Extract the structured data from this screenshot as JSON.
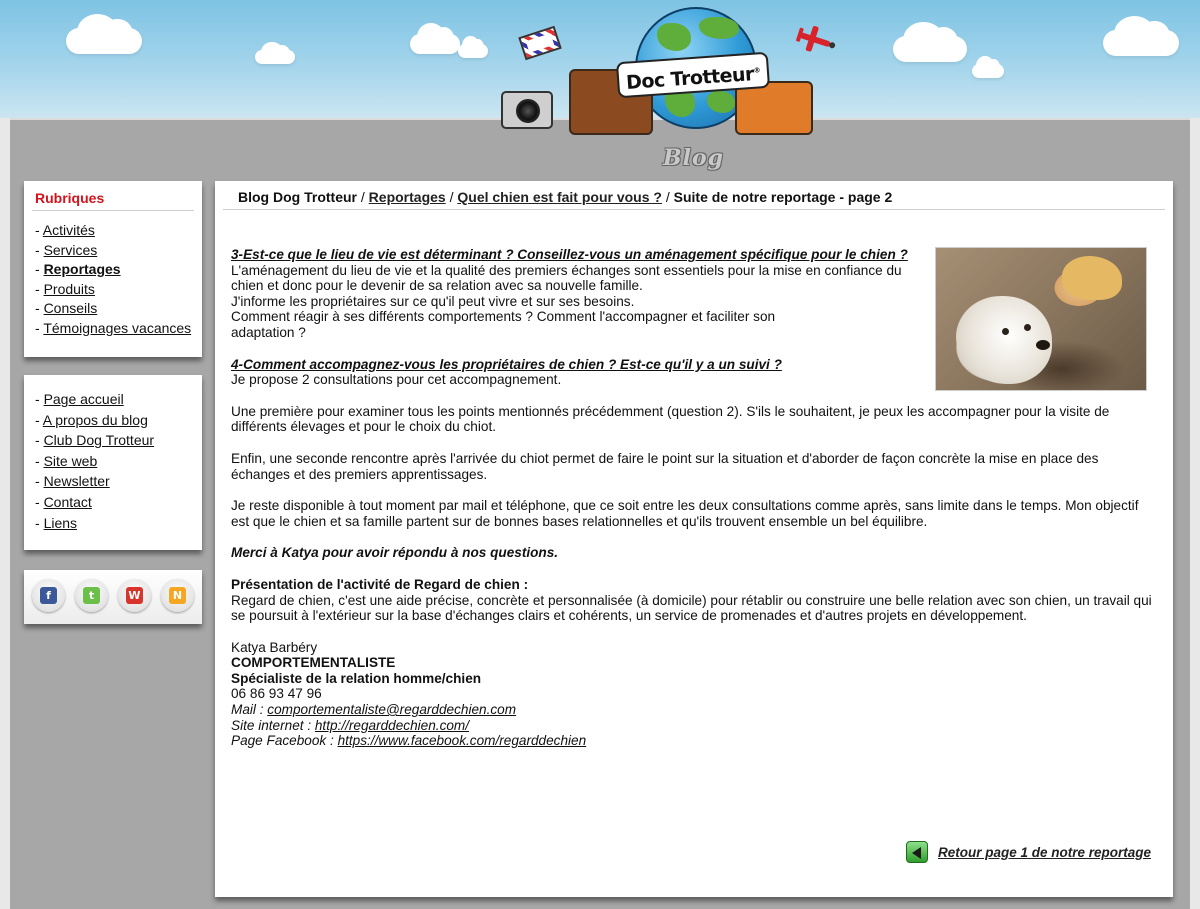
{
  "header": {
    "logo_text": "Doc Trotteur",
    "blog_word": "Blog"
  },
  "sidebar": {
    "rubriques_title": "Rubriques",
    "items": [
      {
        "label": "Activités"
      },
      {
        "label": "Services"
      },
      {
        "label": "Reportages"
      },
      {
        "label": "Produits"
      },
      {
        "label": "Conseils"
      },
      {
        "label": "Témoignages vacances"
      }
    ],
    "links": [
      {
        "label": "Page accueil"
      },
      {
        "label": "A propos du blog"
      },
      {
        "label": "Club Dog Trotteur"
      },
      {
        "label": "Site web"
      },
      {
        "label": "Newsletter"
      },
      {
        "label": "Contact"
      },
      {
        "label": "Liens"
      }
    ],
    "social": [
      {
        "icon": "facebook-icon",
        "glyph": "f",
        "color": "#3b5998"
      },
      {
        "icon": "twitter-icon",
        "glyph": "t",
        "color": "#6cc04a"
      },
      {
        "icon": "wikio-icon",
        "glyph": "W",
        "color": "#d8342c"
      },
      {
        "icon": "netvibes-icon",
        "glyph": "N",
        "color": "#f5a623"
      }
    ]
  },
  "breadcrumb": {
    "root": "Blog Dog Trotteur",
    "sep": " / ",
    "reportages": "Reportages",
    "article": "Quel chien est fait pour vous ?",
    "current": "Suite de notre reportage - page 2"
  },
  "content": {
    "q3_title": "3-Est-ce que le lieu de vie est déterminant ? Conseillez-vous un aménagement spécifique pour le chien ?",
    "q3_l1": "L'aménagement du lieu de vie et la qualité des premiers échanges sont essentiels pour la mise en confiance du",
    "q3_l2": "chien et donc pour le devenir de sa relation avec sa nouvelle famille.",
    "q3_l3": "J'informe les propriétaires sur ce qu'il peut vivre et sur ses besoins.",
    "q3_l4": "Comment réagir à ses différents comportements ? Comment l'accompagner et faciliter son",
    "q3_l5": "adaptation ?",
    "q4_title": "4-Comment accompagnez-vous les propriétaires de chien ? Est-ce qu'il y a un suivi ?",
    "q4_l1": "Je propose 2 consultations pour cet accompagnement.",
    "p1": "Une première pour examiner tous les points mentionnés précédemment (question 2). S'ils le souhaitent, je peux les accompagner pour la visite de différents élevages et pour le choix du chiot.",
    "p2": "Enfin, une seconde rencontre après l'arrivée du chiot permet de faire le point sur la situation et d'aborder de façon concrète la mise en place des échanges et des premiers apprentissages.",
    "p3": "Je reste disponible à tout moment par mail et téléphone, que ce soit entre les deux consultations comme après, sans limite dans le temps. Mon objectif est que le chien et sa famille partent sur de bonnes bases relationnelles et qu'ils trouvent ensemble un bel équilibre.",
    "thanks": "Merci à Katya pour avoir répondu à nos questions.",
    "presentation_title": "Présentation de l'activité de Regard de chien :",
    "presentation_text": "Regard de chien, c'est une aide précise, concrète et personnalisée (à domicile) pour rétablir ou construire une belle relation avec son chien, un travail qui se poursuit à l'extérieur sur la base d'échanges clairs et cohérents, un service de promenades et d'autres projets en développement.",
    "sig_name": "Katya Barbéry",
    "sig_role": "COMPORTEMENTALISTE",
    "sig_specialty": "Spécialiste de la relation homme/chien",
    "sig_phone": "06 86 93 47 96",
    "mail_label": "Mail : ",
    "mail": "comportementaliste@regarddechien.com",
    "site_label": "Site internet : ",
    "site": "http://regarddechien.com/",
    "fb_label": "Page Facebook : ",
    "fb": "https://www.facebook.com/regarddechien"
  },
  "back_link": "Retour page 1 de notre reportage"
}
